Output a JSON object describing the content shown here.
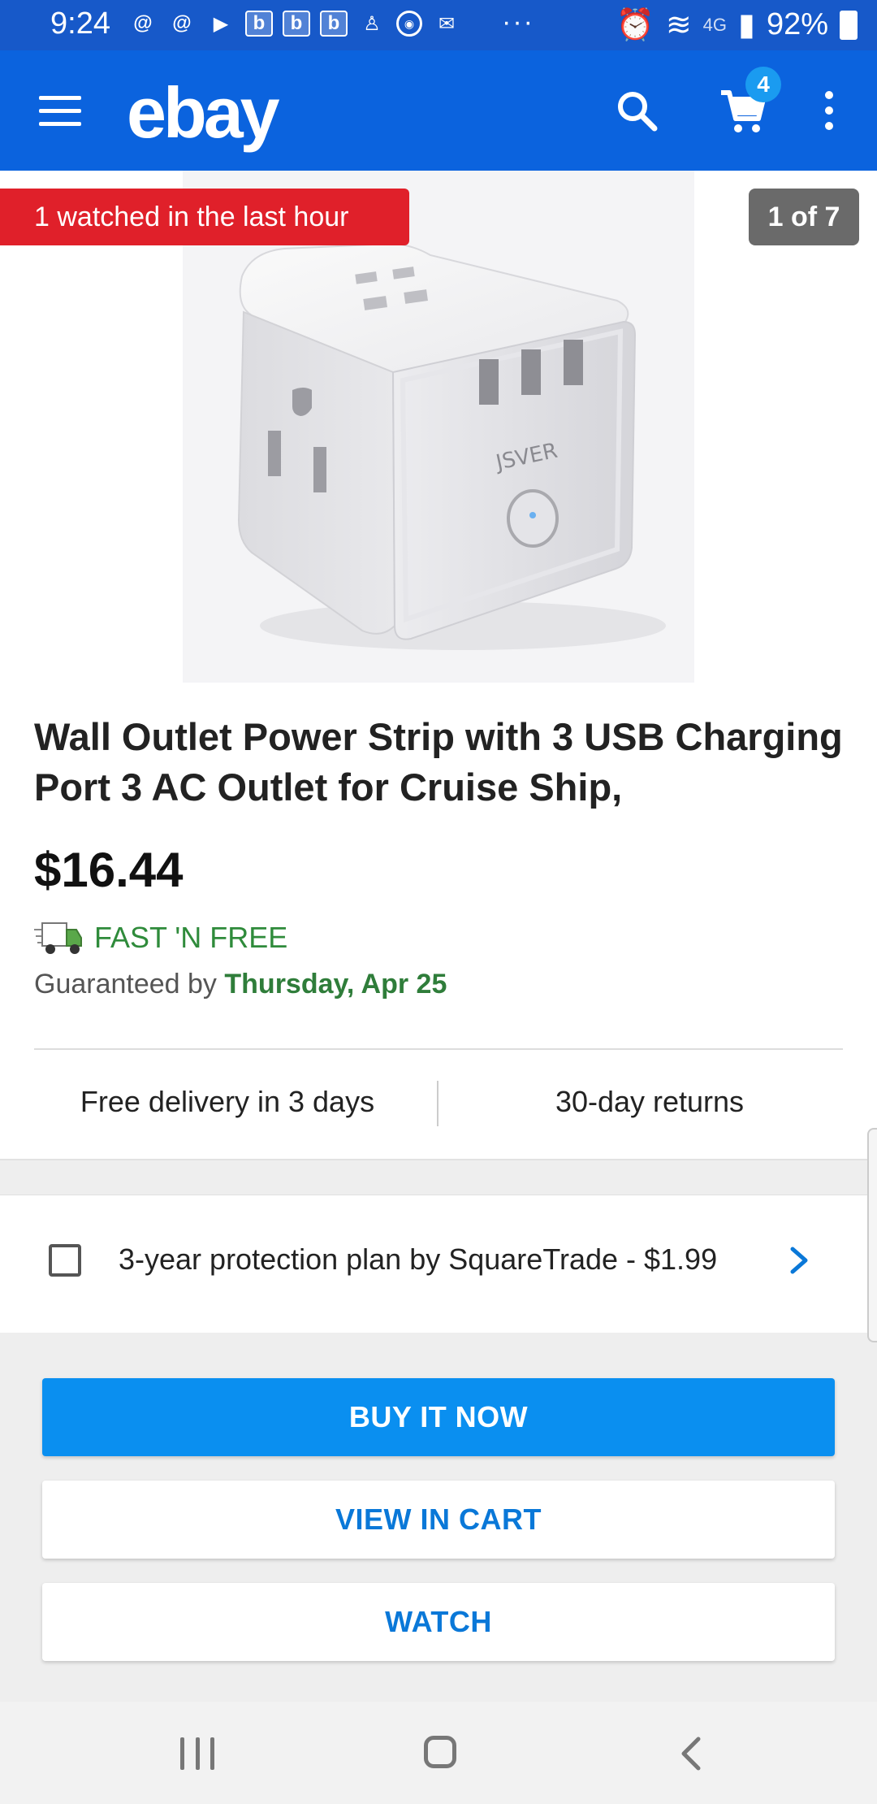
{
  "status_bar": {
    "time": "9:24",
    "left_icons": [
      "threads-icon",
      "threads-icon",
      "youtube-icon",
      "b-icon",
      "b-icon",
      "b-icon",
      "accessibility-icon",
      "wsop-icon",
      "gmail-icon"
    ],
    "overflow": "···",
    "network": "4G",
    "battery": "92%"
  },
  "app_bar": {
    "logo": "ebay",
    "cart_count": "4"
  },
  "hero": {
    "watch_banner": "1 watched in the last hour",
    "image_counter": "1 of 7",
    "brand_text": "JSVER"
  },
  "product": {
    "title": "Wall Outlet Power Strip with 3 USB Charging Port 3 AC Outlet for Cruise Ship,",
    "price": "$16.44",
    "shipping_label": "FAST 'N FREE",
    "guaranteed_prefix": "Guaranteed by ",
    "guaranteed_date": "Thursday, Apr 25"
  },
  "features": {
    "left": "Free delivery in 3 days",
    "right": "30-day returns"
  },
  "protection": {
    "label": "3-year protection plan by SquareTrade - $1.99",
    "checked": false
  },
  "actions": {
    "buy_now": "BUY IT NOW",
    "view_in_cart": "VIEW IN CART",
    "watch": "WATCH"
  },
  "colors": {
    "status_bar": "#1759c9",
    "app_bar": "#0b63de",
    "watch_banner": "#e0202a",
    "buy_button": "#0a8ff0",
    "fast_free": "#2f8b3b"
  }
}
